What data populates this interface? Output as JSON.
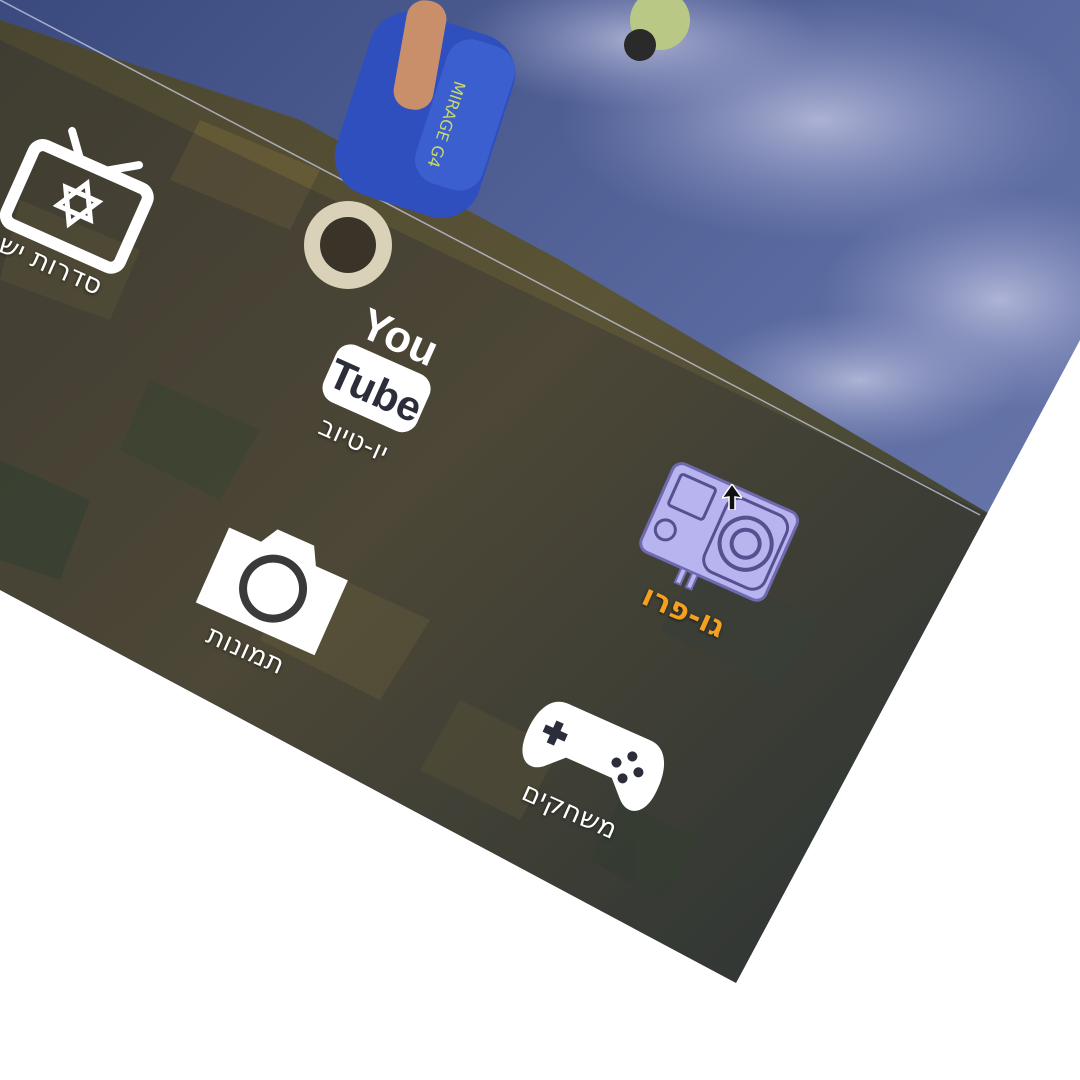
{
  "menu": {
    "items": [
      {
        "id": "tv-series",
        "label": "סדרות יש",
        "icon": "tv-star-of-david-icon",
        "selected": false
      },
      {
        "id": "youtube",
        "label": "יו-טיוב",
        "icon": "youtube-logo-icon",
        "selected": false
      },
      {
        "id": "photos",
        "label": "תמונות",
        "icon": "camera-icon",
        "selected": false
      },
      {
        "id": "gopro",
        "label": "גו-פרו",
        "icon": "action-camera-icon",
        "selected": true
      },
      {
        "id": "games",
        "label": "משחקים",
        "icon": "gamepad-icon",
        "selected": false
      }
    ],
    "youtube_logo": {
      "top": "You",
      "bottom": "Tube"
    }
  },
  "background": {
    "subject": "skydivers above farmland",
    "jumpsuit_text": "MIRAGE G4"
  },
  "colors": {
    "selected_label": "#f5a01e",
    "selected_icon": "#b8b4f0",
    "icon": "#ffffff",
    "overlay": "#2a2d4a"
  }
}
